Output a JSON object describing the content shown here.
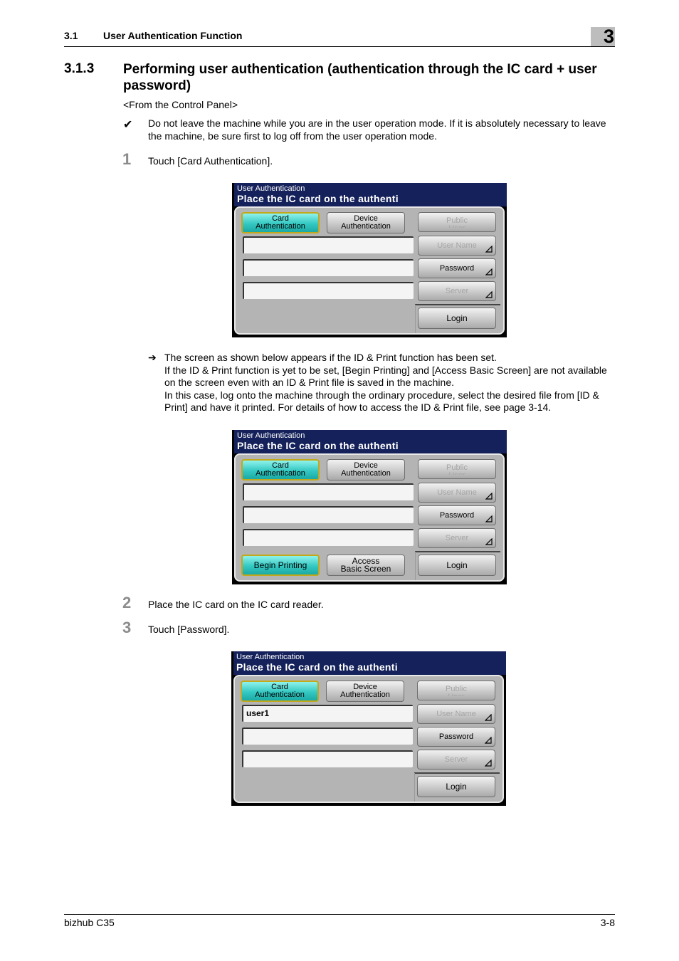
{
  "header": {
    "section_num": "3.1",
    "section_title": "User Authentication Function",
    "chapter": "3"
  },
  "section": {
    "num": "3.1.3",
    "title": "Performing user authentication (authentication through the IC card + user password)"
  },
  "from_panel": "<From the Control Panel>",
  "note": {
    "icon": "✔",
    "text": "Do not leave the machine while you are in the user operation mode. If it is absolutely necessary to leave the machine, be sure first to log off from the user operation mode."
  },
  "steps": [
    {
      "num": "1",
      "text": "Touch [Card Authentication]."
    },
    {
      "num": "2",
      "text": "Place the IC card on the IC card reader."
    },
    {
      "num": "3",
      "text": "Touch [Password]."
    }
  ],
  "arrow_note": {
    "icon": "➔",
    "lines": [
      "The screen as shown below appears if the ID & Print function has been set.",
      "If the ID & Print function is yet to be set, [Begin Printing] and [Access Basic Screen] are not available on the screen even with an ID & Print file is saved in the machine.",
      "In this case, log onto the machine through the ordinary procedure, select the desired file from [ID & Print] and have it printed. For details of how to access the ID & Print file, see page 3-14."
    ]
  },
  "panels": [
    {
      "title_small": "User Authentication",
      "title_large": "Place the IC card on the authenti",
      "card_auth": [
        "Card",
        "Authentication"
      ],
      "device_auth": [
        "Device",
        "Authentication"
      ],
      "public_user": [
        "Public",
        "User"
      ],
      "user_name": "User Name",
      "password": "Password",
      "server": "Server",
      "login": "Login",
      "fields": [
        "",
        "",
        ""
      ]
    },
    {
      "title_small": "User Authentication",
      "title_large": "Place the IC card on the authenti",
      "card_auth": [
        "Card",
        "Authentication"
      ],
      "device_auth": [
        "Device",
        "Authentication"
      ],
      "public_user": [
        "Public",
        "User"
      ],
      "user_name": "User Name",
      "password": "Password",
      "server": "Server",
      "login": "Login",
      "fields": [
        "",
        "",
        ""
      ],
      "begin_printing": "Begin Printing",
      "access_basic": [
        "Access",
        "Basic Screen"
      ]
    },
    {
      "title_small": "User Authentication",
      "title_large": "Place the IC card on the authenti",
      "card_auth": [
        "Card",
        "Authentication"
      ],
      "device_auth": [
        "Device",
        "Authentication"
      ],
      "public_user": [
        "Public",
        "User"
      ],
      "user_name": "User Name",
      "password": "Password",
      "server": "Server",
      "login": "Login",
      "fields": [
        "user1",
        "",
        ""
      ]
    }
  ],
  "footer": {
    "left": "bizhub C35",
    "right": "3-8"
  }
}
